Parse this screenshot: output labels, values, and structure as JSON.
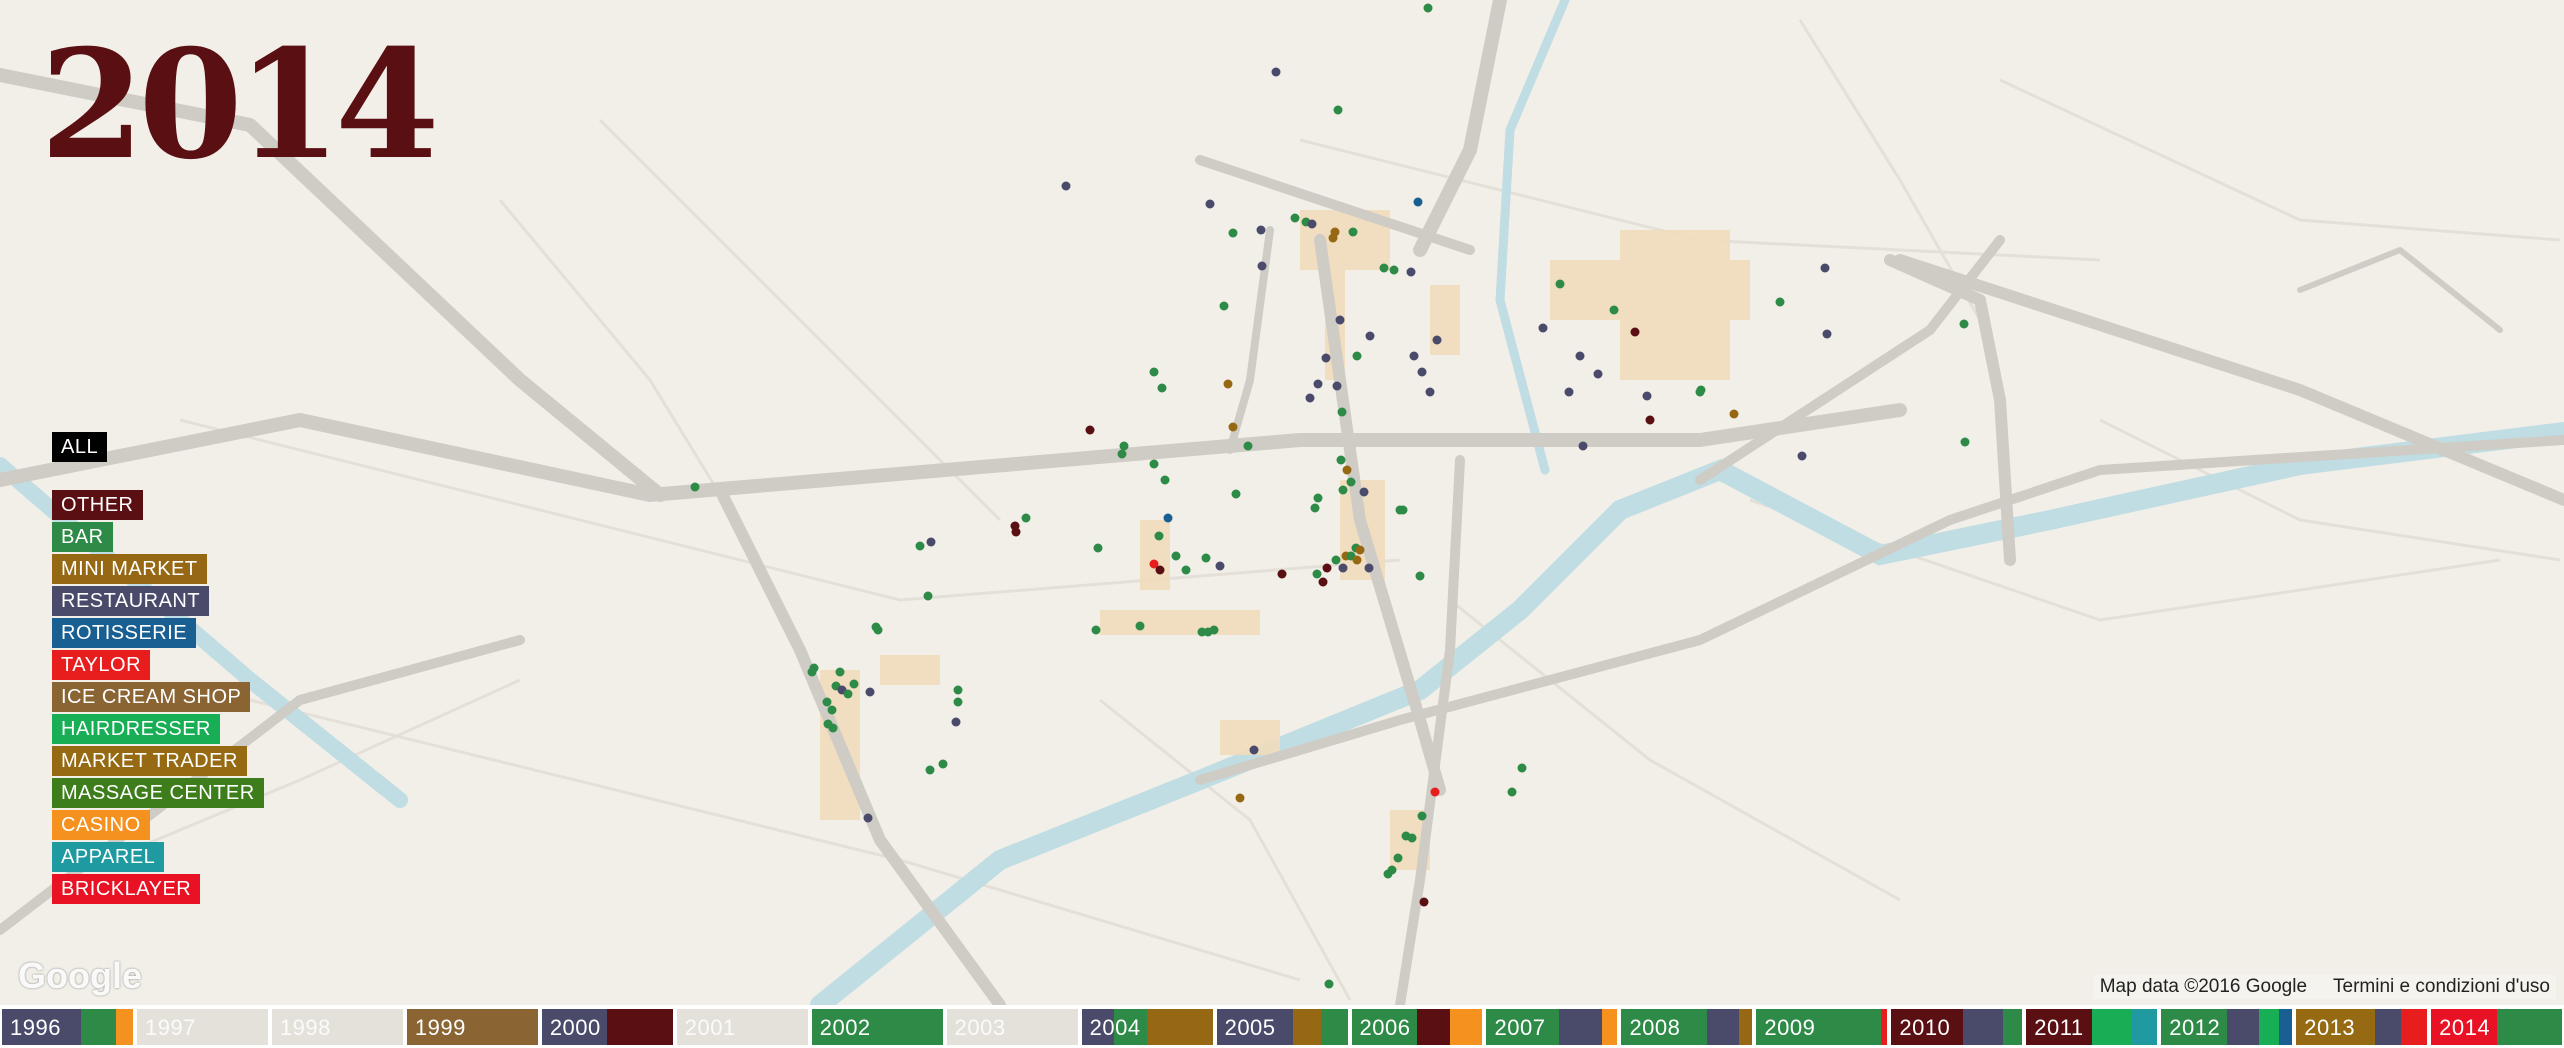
{
  "year": "2014",
  "legend": {
    "all_label": "ALL",
    "categories": [
      {
        "label": "OTHER",
        "color": "#5a0f12"
      },
      {
        "label": "BAR",
        "color": "#2e8b47"
      },
      {
        "label": "MINI MARKET",
        "color": "#966814"
      },
      {
        "label": "RESTAURANT",
        "color": "#4a4a6b"
      },
      {
        "label": "ROTISSERIE",
        "color": "#1a5f91"
      },
      {
        "label": "TAYLOR",
        "color": "#e81e1e"
      },
      {
        "label": "ICE CREAM SHOP",
        "color": "#8a6433"
      },
      {
        "label": "HAIRDRESSER",
        "color": "#17ae55"
      },
      {
        "label": "MARKET TRADER",
        "color": "#966a12"
      },
      {
        "label": "MASSAGE CENTER",
        "color": "#3e7d1c"
      },
      {
        "label": "CASINO",
        "color": "#f5911f"
      },
      {
        "label": "APPAREL",
        "color": "#1e9aa0"
      },
      {
        "label": "BRICKLAYER",
        "color": "#e81224"
      }
    ]
  },
  "attribution": {
    "map_data": "Map data ©2016 Google",
    "terms": "Termini e condizioni d'uso",
    "logo": "Google"
  },
  "timeline": [
    {
      "year": "1996",
      "segments": [
        [
          0.6,
          "#4a4a6b"
        ],
        [
          0.27,
          "#2e8b47"
        ],
        [
          0.13,
          "#f5911f"
        ]
      ]
    },
    {
      "year": "1997",
      "segments": []
    },
    {
      "year": "1998",
      "segments": []
    },
    {
      "year": "1999",
      "segments": [
        [
          1.0,
          "#8a6433"
        ]
      ]
    },
    {
      "year": "2000",
      "segments": [
        [
          0.5,
          "#4a4a6b"
        ],
        [
          0.5,
          "#5a0f12"
        ]
      ]
    },
    {
      "year": "2001",
      "segments": []
    },
    {
      "year": "2002",
      "segments": [
        [
          1.0,
          "#2e8b47"
        ]
      ]
    },
    {
      "year": "2003",
      "segments": []
    },
    {
      "year": "2004",
      "segments": [
        [
          0.25,
          "#4a4a6b"
        ],
        [
          0.25,
          "#2e8b47"
        ],
        [
          0.5,
          "#966814"
        ]
      ]
    },
    {
      "year": "2005",
      "segments": [
        [
          0.58,
          "#4a4a6b"
        ],
        [
          0.22,
          "#966814"
        ],
        [
          0.2,
          "#2e8b47"
        ]
      ]
    },
    {
      "year": "2006",
      "segments": [
        [
          0.5,
          "#2e8b47"
        ],
        [
          0.25,
          "#5a0f12"
        ],
        [
          0.25,
          "#f5911f"
        ]
      ]
    },
    {
      "year": "2007",
      "segments": [
        [
          0.55,
          "#2e8b47"
        ],
        [
          0.33,
          "#4a4a6b"
        ],
        [
          0.12,
          "#f5911f"
        ]
      ]
    },
    {
      "year": "2008",
      "segments": [
        [
          0.65,
          "#2e8b47"
        ],
        [
          0.25,
          "#4a4a6b"
        ],
        [
          0.1,
          "#966814"
        ]
      ]
    },
    {
      "year": "2009",
      "segments": [
        [
          0.95,
          "#2e8b47"
        ],
        [
          0.05,
          "#e81e1e"
        ]
      ]
    },
    {
      "year": "2010",
      "segments": [
        [
          0.55,
          "#5a0f12"
        ],
        [
          0.3,
          "#4a4a6b"
        ],
        [
          0.15,
          "#2e8b47"
        ]
      ]
    },
    {
      "year": "2011",
      "segments": [
        [
          0.5,
          "#5a0f12"
        ],
        [
          0.3,
          "#17ae55"
        ],
        [
          0.2,
          "#1e9aa0"
        ]
      ]
    },
    {
      "year": "2012",
      "segments": [
        [
          0.5,
          "#2e8b47"
        ],
        [
          0.25,
          "#4a4a6b"
        ],
        [
          0.15,
          "#17ae55"
        ],
        [
          0.1,
          "#1a5f91"
        ]
      ]
    },
    {
      "year": "2013",
      "segments": [
        [
          0.6,
          "#966a12"
        ],
        [
          0.2,
          "#4a4a6b"
        ],
        [
          0.2,
          "#e81e1e"
        ]
      ]
    },
    {
      "year": "2014",
      "segments": [
        [
          0.5,
          "#e81224"
        ],
        [
          0.5,
          "#2e8b47"
        ]
      ]
    }
  ]
}
